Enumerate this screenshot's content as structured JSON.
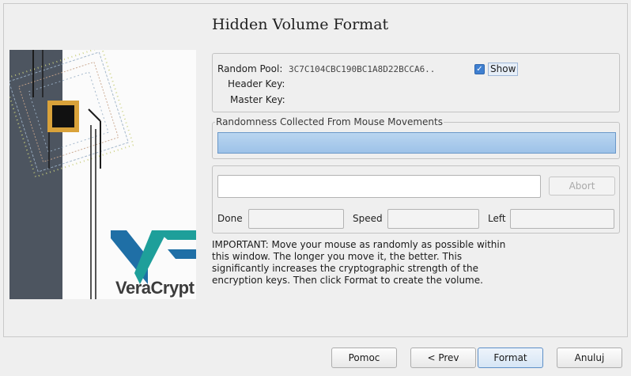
{
  "wizard": {
    "title": "Hidden Volume Format",
    "brand": "VeraCrypt"
  },
  "pool": {
    "random_pool_label": "Random Pool:",
    "random_pool_value": "3C7C104CBC190BC1A8D22BCCA6..",
    "show_checked": true,
    "show_label": "Show",
    "header_key_label": "Header Key:",
    "master_key_label": "Master Key:"
  },
  "randomness": {
    "legend": "Randomness Collected From Mouse Movements",
    "level": 1.0
  },
  "progress": {
    "abort_label": "Abort",
    "done_label": "Done",
    "speed_label": "Speed",
    "left_label": "Left"
  },
  "note": "IMPORTANT: Move your mouse as randomly as possible within this window. The longer you move it, the better. This significantly increases the cryptographic strength of the encryption keys. Then click Format to create the volume.",
  "buttons": {
    "help": "Pomoc",
    "prev": "< Prev",
    "format": "Format",
    "cancel": "Anuluj"
  },
  "colors": {
    "progress_fill": "#a8cbed",
    "checkbox": "#3f7fd0",
    "logo_teal": "#1e9f9a",
    "logo_blue": "#1f6fa6"
  }
}
